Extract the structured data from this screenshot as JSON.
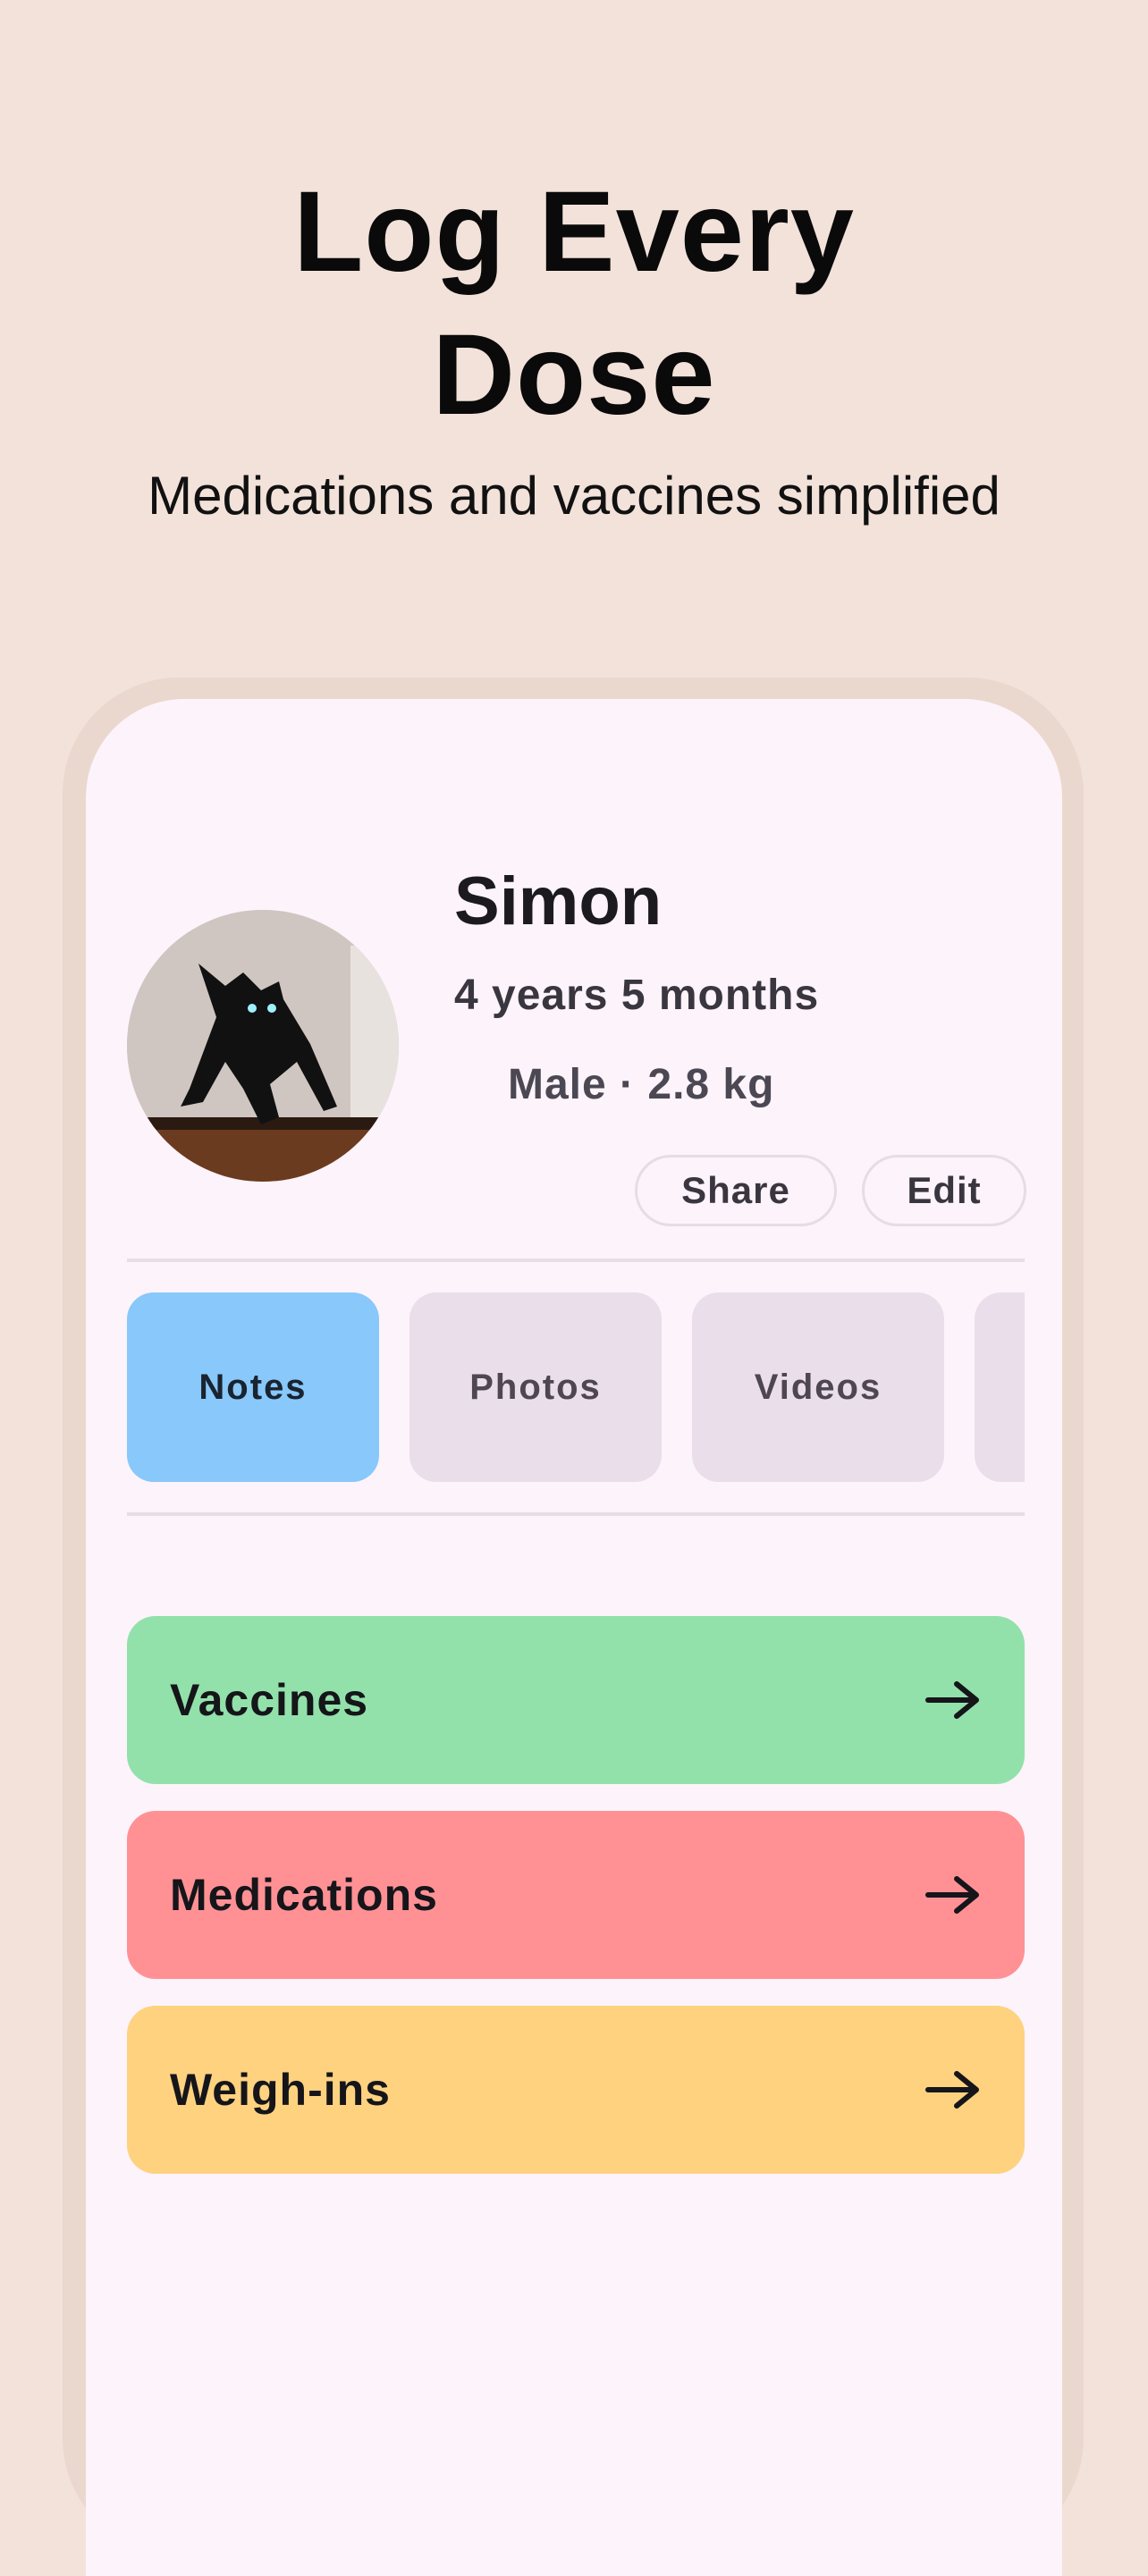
{
  "promo": {
    "headline_line1": "Log Every",
    "headline_line2": "Dose",
    "subtitle": "Medications and vaccines simplified"
  },
  "profile": {
    "name": "Simon",
    "age": "4 years 5 months",
    "meta": "Male · 2.8 kg",
    "share_label": "Share",
    "edit_label": "Edit"
  },
  "tabs": [
    {
      "label": "Notes",
      "selected": true
    },
    {
      "label": "Photos"
    },
    {
      "label": "Videos"
    }
  ],
  "sections": [
    {
      "label": "Vaccines",
      "color": "#92e1aa",
      "icon": "arrow-right-icon"
    },
    {
      "label": "Medications",
      "color": "#ff9195",
      "icon": "arrow-right-icon"
    },
    {
      "label": "Weigh-ins",
      "color": "#fed27f",
      "icon": "arrow-right-icon"
    }
  ],
  "colors": {
    "background": "#f2e2da",
    "screen": "#fdf3fb",
    "tab_selected": "#88c8fb",
    "tab_default": "#e9dee9"
  }
}
